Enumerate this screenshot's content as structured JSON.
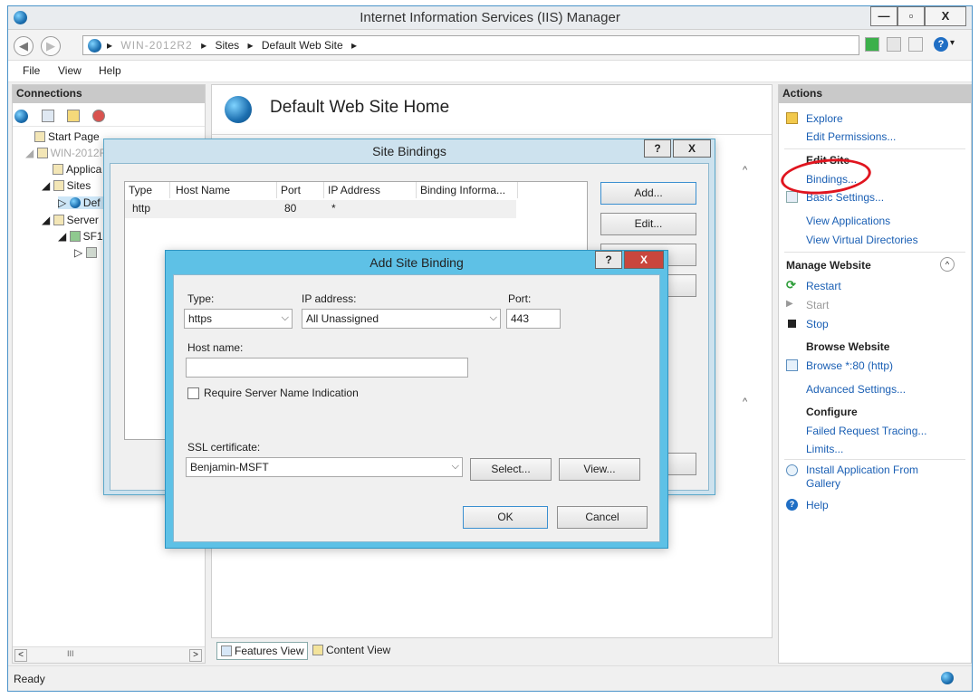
{
  "window": {
    "title": "Internet Information Services (IIS) Manager",
    "caption_min": "—",
    "caption_max": "▫",
    "caption_close": "X"
  },
  "address": {
    "crumbs": [
      "WIN-2012R2",
      "Sites",
      "Default Web Site"
    ],
    "sep": "▸"
  },
  "menu": {
    "file": "File",
    "view": "View",
    "help": "Help"
  },
  "connections": {
    "header": "Connections",
    "tree": [
      {
        "label": "Start Page"
      },
      {
        "label": "WIN-2012R2"
      },
      {
        "label": "Applica"
      },
      {
        "label": "Sites"
      },
      {
        "label": "Def"
      },
      {
        "label": "Server"
      },
      {
        "label": "SF1"
      },
      {
        "label": ""
      }
    ],
    "scroll_mid": "III"
  },
  "center": {
    "title": "Default Web Site Home",
    "tab_features": "Features View",
    "tab_content": "Content View"
  },
  "actions": {
    "header": "Actions",
    "explore": "Explore",
    "edit_permissions": "Edit Permissions...",
    "edit_site": "Edit Site",
    "bindings": "Bindings...",
    "basic_settings": "Basic Settings...",
    "view_applications": "View Applications",
    "view_virtual_dirs": "View Virtual Directories",
    "manage_website": "Manage Website",
    "restart": "Restart",
    "start": "Start",
    "stop": "Stop",
    "browse_website": "Browse Website",
    "browse_80": "Browse *:80 (http)",
    "advanced_settings": "Advanced Settings...",
    "configure": "Configure",
    "failed_request": "Failed Request Tracing...",
    "limits": "Limits...",
    "install_app": "Install Application From",
    "gallery": "Gallery",
    "help": "Help"
  },
  "status": {
    "text": "Ready"
  },
  "site_bindings": {
    "title": "Site Bindings",
    "help_btn": "?",
    "close_btn": "X",
    "columns": [
      "Type",
      "Host Name",
      "Port",
      "IP Address",
      "Binding Informa..."
    ],
    "rows": [
      {
        "type": "http",
        "host": "",
        "port": "80",
        "ip": "*",
        "info": ""
      }
    ],
    "add": "Add...",
    "edit": "Edit..."
  },
  "add_binding": {
    "title": "Add Site Binding",
    "help_btn": "?",
    "close_btn": "X",
    "type_label": "Type:",
    "type_value": "https",
    "ip_label": "IP address:",
    "ip_value": "All Unassigned",
    "port_label": "Port:",
    "port_value": "443",
    "host_label": "Host name:",
    "host_value": "",
    "sni_label": "Require Server Name Indication",
    "ssl_label": "SSL certificate:",
    "ssl_value": "Benjamin-MSFT",
    "select": "Select...",
    "view": "View...",
    "ok": "OK",
    "cancel": "Cancel"
  }
}
